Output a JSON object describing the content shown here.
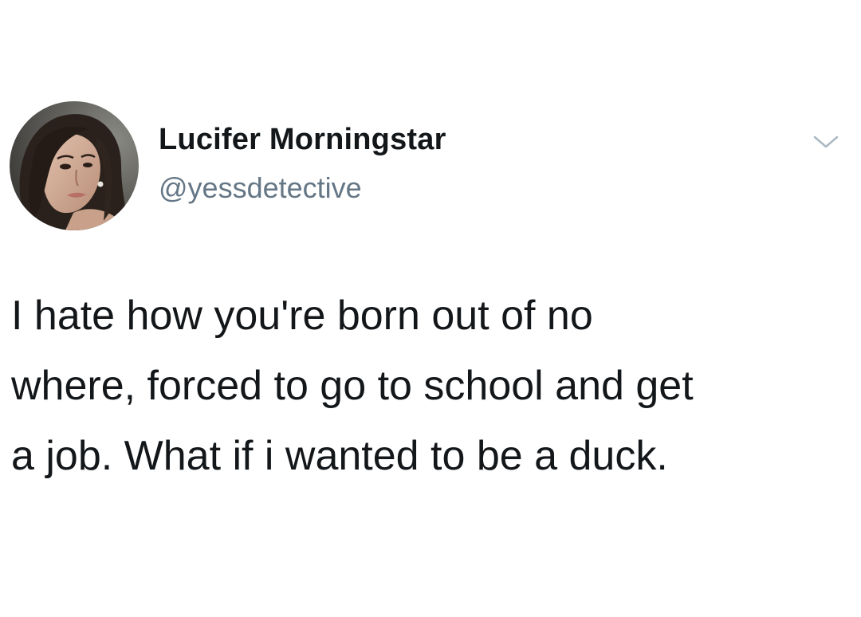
{
  "tweet": {
    "author": {
      "display_name": "Lucifer Morningstar",
      "handle": "@yessdetective",
      "avatar_icon": "avatar-photo-icon"
    },
    "menu_icon": "chevron-down-icon",
    "text_lines": [
      "I hate how you're born out of no",
      "where, forced to go to school and get",
      "a job. What if i wanted to be a duck."
    ]
  },
  "colors": {
    "name": "#14171a",
    "handle": "#657786",
    "text": "#14171a",
    "chevron": "#aab8c2",
    "background": "#ffffff"
  }
}
